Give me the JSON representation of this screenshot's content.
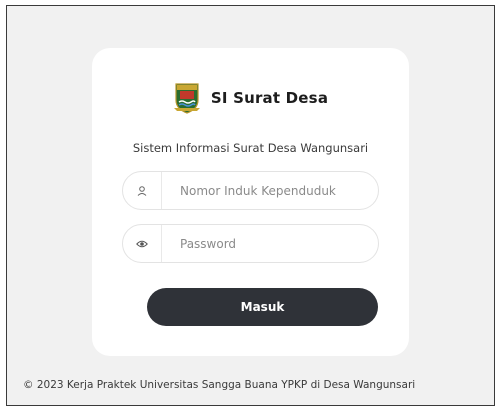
{
  "app": {
    "title": "SI Surat Desa",
    "subtitle": "Sistem Informasi Surat Desa Wangunsari"
  },
  "form": {
    "nik": {
      "placeholder": "Nomor Induk Kependuduk",
      "value": "",
      "icon": "user-icon"
    },
    "password": {
      "placeholder": "Password",
      "value": "",
      "icon": "eye-icon"
    },
    "submit_label": "Masuk"
  },
  "footer": {
    "text": "© 2023 Kerja Praktek Universitas Sangga Buana YPKP di Desa Wangunsari"
  },
  "colors": {
    "page_background": "#f1f1f1",
    "card_background": "#ffffff",
    "button_background": "#2f3238",
    "button_text": "#ffffff"
  }
}
